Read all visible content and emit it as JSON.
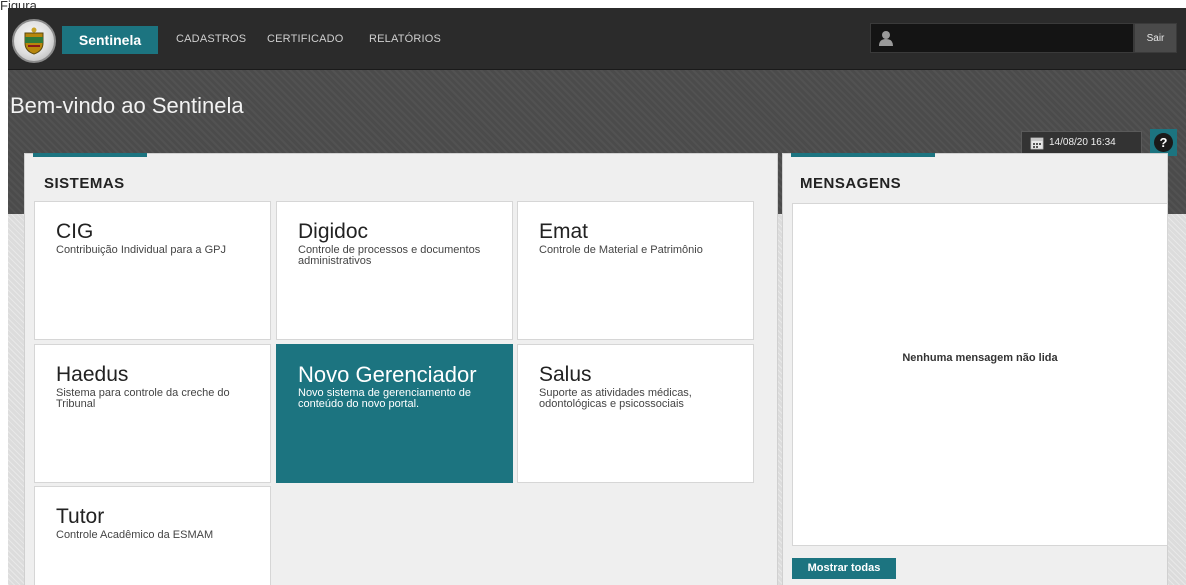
{
  "caption": "Figura",
  "nav": {
    "brand": "Sentinela",
    "links": [
      "CADASTROS",
      "CERTIFICADO",
      "RELATÓRIOS"
    ],
    "user_name": "",
    "logout": "Sair",
    "logo_icon": "coat-of-arms-icon",
    "user_icon": "user-icon"
  },
  "header": {
    "title": "Bem-vindo ao Sentinela",
    "datetime": "14/08/20 16:34",
    "calendar_icon": "calendar-icon",
    "help": "?"
  },
  "sistemas": {
    "title": "SISTEMAS",
    "tiles": [
      {
        "name": "CIG",
        "desc": "Contribuição Individual para a GPJ"
      },
      {
        "name": "Digidoc",
        "desc": "Controle de processos e documentos administrativos"
      },
      {
        "name": "Emat",
        "desc": "Controle de Material e Patrimônio"
      },
      {
        "name": "Haedus",
        "desc": "Sistema para controle da creche do Tribunal"
      },
      {
        "name": "Novo Gerenciador",
        "desc": "Novo sistema de gerenciamento de conteúdo do novo portal."
      },
      {
        "name": "Salus",
        "desc": "Suporte as atividades médicas, odontológicas e psicossociais"
      },
      {
        "name": "Tutor",
        "desc": "Controle Acadêmico da ESMAM"
      }
    ]
  },
  "mensagens": {
    "title": "MENSAGENS",
    "empty": "Nenhuma mensagem não lida",
    "show_all": "Mostrar todas"
  },
  "colors": {
    "accent": "#1c7480",
    "topbar": "#2b2b2b",
    "band": "#4b4b4b"
  }
}
